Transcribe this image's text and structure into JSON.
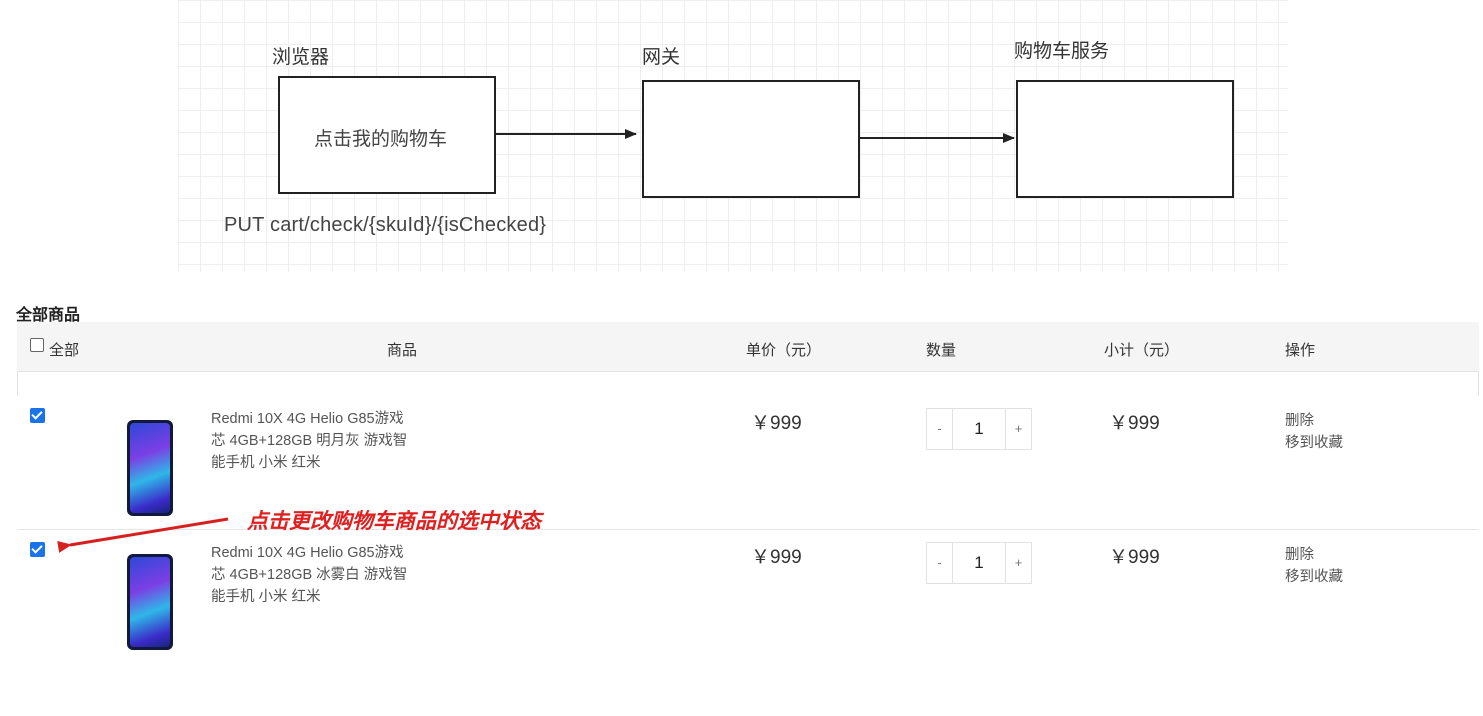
{
  "diagram": {
    "browser_label": "浏览器",
    "gateway_label": "网关",
    "cart_service_label": "购物车服务",
    "browser_box_text": "点击我的购物车",
    "api_text": "PUT  cart/check/{skuId}/{isChecked}"
  },
  "cart": {
    "title": "全部商品",
    "header": {
      "select_all": "全部",
      "product": "商品",
      "unit_price": "单价（元）",
      "quantity": "数量",
      "subtotal": "小计（元）",
      "actions": "操作"
    },
    "items": [
      {
        "checked": true,
        "name": "Redmi 10X 4G Helio G85游戏芯 4GB+128GB 明月灰 游戏智能手机 小米 红米",
        "price": "￥999",
        "quantity": "1",
        "subtotal": "￥999",
        "delete_label": "删除",
        "favorite_label": "移到收藏",
        "minus": "-",
        "plus": "+"
      },
      {
        "checked": true,
        "name": "Redmi 10X 4G Helio G85游戏芯 4GB+128GB 冰雾白 游戏智能手机 小米 红米",
        "price": "￥999",
        "quantity": "1",
        "subtotal": "￥999",
        "delete_label": "删除",
        "favorite_label": "移到收藏",
        "minus": "-",
        "plus": "+"
      }
    ]
  },
  "annotation": {
    "text": "点击更改购物车商品的选中状态",
    "color": "#e02020"
  },
  "colors": {
    "checkbox": "#1a73e8",
    "header_bg": "#f5f5f5"
  }
}
